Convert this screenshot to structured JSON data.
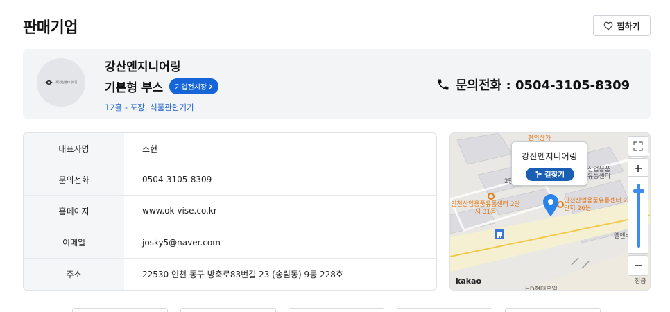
{
  "header": {
    "title": "판매기업",
    "wish_label": "찜하기"
  },
  "company": {
    "name": "강산엔지니어링",
    "booth_type": "기본형 부스",
    "exhibit_button": "기업전시장",
    "hall_info": "12홀 - 포장, 식품관련기기",
    "logo_text": "(주)강산엔지니어링",
    "phone_text": "문의전화 : 0504-3105-8309"
  },
  "info_table": {
    "rows": [
      {
        "key": "대표자명",
        "value": "조현"
      },
      {
        "key": "문의전화",
        "value": "0504-3105-8309"
      },
      {
        "key": "홈페이지",
        "value": "www.ok-vise.co.kr"
      },
      {
        "key": "이메일",
        "value": "josky5@naver.com"
      },
      {
        "key": "주소",
        "value": "22530 인천 동구 방축로83번길 23 (송림동) 9동 228호"
      }
    ]
  },
  "map": {
    "popup_name": "강산엔지니어링",
    "route_label": "길찾기",
    "provider": "kakao",
    "labels": {
      "top": "편의상가",
      "left_center": "인천산업용품유통센터 2단지 31동",
      "right_center": "인천산업용품유통센터 2단지 26동",
      "upper_right": "산업용품 유통센터",
      "upper_left": "2단",
      "mid_right": "엘앤비",
      "bottom": "HD현대오일",
      "bottom_right": "정금"
    },
    "colors": {
      "pin": "#2a83e8",
      "route_button": "#1a5fb4",
      "accent": "#1565d8"
    }
  }
}
